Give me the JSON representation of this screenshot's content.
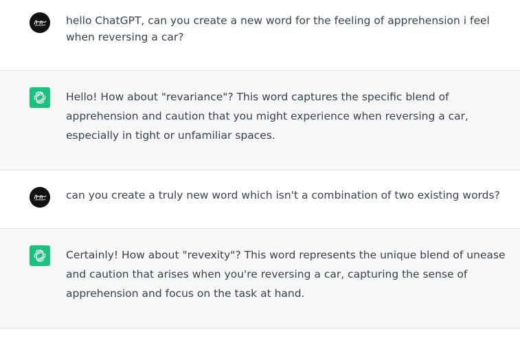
{
  "messages": [
    {
      "role": "user",
      "avatar_icon": "user-signature-avatar",
      "text": "hello ChatGPT, can you create a new word for the feeling of apprehension i feel when reversing a car?"
    },
    {
      "role": "assistant",
      "avatar_icon": "openai-logo-icon",
      "text": "Hello! How about \"revariance\"? This word captures the specific blend of apprehension and caution that you might experience when reversing a car, especially in tight or unfamiliar spaces."
    },
    {
      "role": "user",
      "avatar_icon": "user-signature-avatar",
      "text": "can you create a truly new word which isn't a combination of two existing words?"
    },
    {
      "role": "assistant",
      "avatar_icon": "openai-logo-icon",
      "text": "Certainly! How about \"revexity\"? This word represents the unique blend of unease and caution that arises when you're reversing a car, capturing the sense of apprehension and focus on the task at hand."
    }
  ],
  "colors": {
    "assistant_bg": "#f7f7f8",
    "user_bg": "#ffffff",
    "bot_avatar": "#19c37d",
    "user_avatar": "#111111",
    "text": "#374151"
  }
}
